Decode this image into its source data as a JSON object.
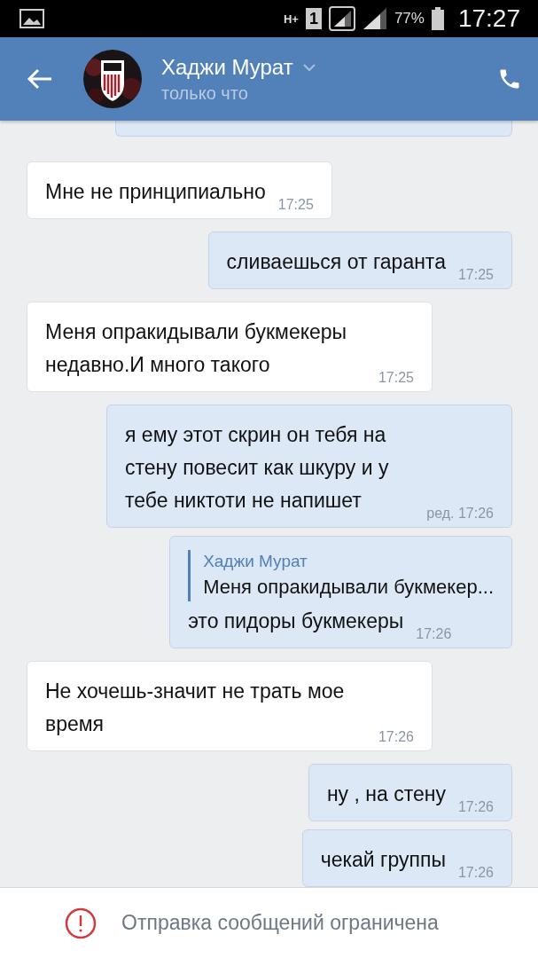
{
  "status_bar": {
    "network": "H+",
    "sim": "1",
    "battery": "77%",
    "time": "17:27"
  },
  "header": {
    "name": "Хаджи Мурат",
    "status": "только что"
  },
  "messages": [
    {
      "kind": "in",
      "text": "Мне не принципиально",
      "time": "17:25"
    },
    {
      "kind": "out",
      "text": "сливаешься от гаранта",
      "time": "17:25"
    },
    {
      "kind": "in",
      "text": "Меня опракидывали букмекеры недавно.И много такого",
      "time": "17:25"
    },
    {
      "kind": "out",
      "text": "я ему этот скрин он тебя на стену повесит как шкуру и у тебе никтоти не напишет",
      "edited": "ред.",
      "time": "17:26"
    },
    {
      "kind": "out",
      "quote": {
        "author": "Хаджи Мурат",
        "text": "Меня опракидывали букмекер..."
      },
      "text": "это пидоры букмекеры",
      "time": "17:26"
    },
    {
      "kind": "in",
      "text": "Не хочешь-значит не трать мое время",
      "time": "17:26"
    },
    {
      "kind": "out",
      "text": "ну , на стену",
      "time": "17:26"
    },
    {
      "kind": "out",
      "text": "чекай группы",
      "time": "17:26"
    }
  ],
  "footer": {
    "notice": "Отправка сообщений ограничена"
  }
}
